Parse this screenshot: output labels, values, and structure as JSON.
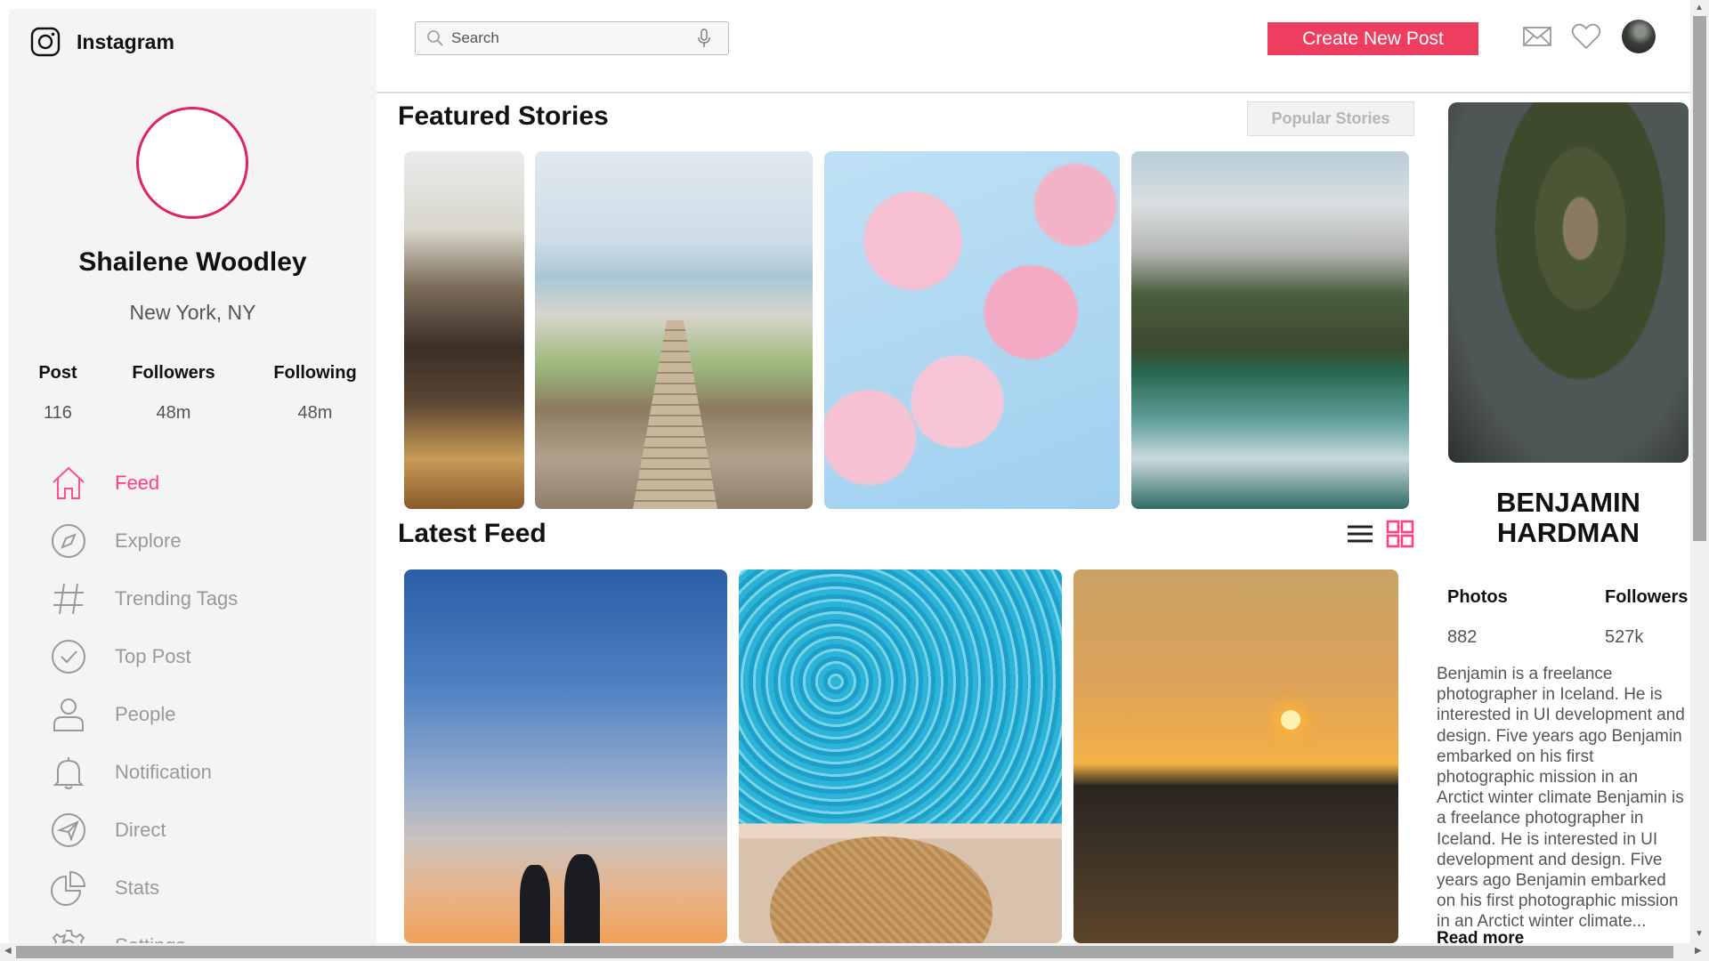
{
  "brand": {
    "name": "Instagram",
    "icon": "instagram-logo-icon"
  },
  "profile": {
    "name": "Shailene Woodley",
    "location": "New York, NY",
    "stats": [
      {
        "label": "Post",
        "value": "116"
      },
      {
        "label": "Followers",
        "value": "48m"
      },
      {
        "label": "Following",
        "value": "48m"
      }
    ]
  },
  "nav": {
    "items": [
      {
        "label": "Feed",
        "icon": "home-icon",
        "active": true
      },
      {
        "label": "Explore",
        "icon": "compass-icon"
      },
      {
        "label": "Trending Tags",
        "icon": "hashtag-icon"
      },
      {
        "label": "Top Post",
        "icon": "check-circle-icon"
      },
      {
        "label": "People",
        "icon": "person-icon"
      },
      {
        "label": "Notification",
        "icon": "bell-icon"
      },
      {
        "label": "Direct",
        "icon": "send-icon"
      },
      {
        "label": "Stats",
        "icon": "pie-chart-icon"
      },
      {
        "label": "Settings",
        "icon": "gear-icon"
      }
    ],
    "active_color": "#ff3d7f"
  },
  "topbar": {
    "search_placeholder": "Search",
    "create_label": "Create New Post",
    "create_color": "#ee3e5f",
    "icons": [
      "mail-icon",
      "heart-icon",
      "user-avatar"
    ]
  },
  "stories": {
    "title": "Featured Stories",
    "popular_label": "Popular Stories",
    "images": [
      "coastal-cliffs-clouds",
      "wooden-boardwalk-beach",
      "cherry-blossoms",
      "mountain-lake-reflection"
    ]
  },
  "feed": {
    "title": "Latest Feed",
    "view_modes": [
      "list-view-icon",
      "grid-view-icon"
    ],
    "active_view": "grid",
    "images": [
      "couple-silhouette-sunset",
      "legs-straw-hat-pool",
      "ocean-sunset-waves"
    ]
  },
  "featured_user": {
    "name_line1": "BENJAMIN",
    "name_line2": "HARDMAN",
    "stats": [
      {
        "label": "Photos",
        "value": "882"
      },
      {
        "label": "Followers",
        "value": "527k"
      }
    ],
    "bio_lines": [
      "Benjamin is a freelance",
      "photographer in Iceland. He is",
      "interested in UI development and",
      "design. Five years ago Benjamin",
      "embarked on his first",
      "photographic mission in an",
      "Arctict winter climate Benjamin is",
      "a freelance photographer in",
      "Iceland. He is interested in UI",
      "development and design. Five",
      "years ago Benjamin embarked",
      "on his first photographic mission",
      "in an Arctict winter climate..."
    ],
    "read_more": "Read more"
  }
}
